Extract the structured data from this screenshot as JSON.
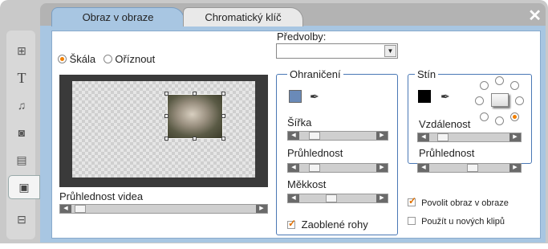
{
  "tabs": [
    {
      "label": "Obraz v obraze"
    },
    {
      "label": "Chromatický klíč"
    }
  ],
  "close_icon": "close-icon",
  "sidebar": {
    "items": [
      {
        "icon": "layout-icon"
      },
      {
        "icon": "title-text-icon"
      },
      {
        "icon": "audio-clip-icon"
      },
      {
        "icon": "camera-icon"
      },
      {
        "icon": "clapper-icon"
      },
      {
        "icon": "picture-in-picture-icon"
      },
      {
        "icon": "filmstrip-icon"
      }
    ]
  },
  "mode": {
    "scale_label": "Škála",
    "crop_label": "Oříznout",
    "selected": "scale"
  },
  "presets": {
    "label": "Předvolby:",
    "value": ""
  },
  "video_opacity": {
    "label": "Průhlednost videa",
    "value": 0.02
  },
  "border": {
    "title": "Ohraničení",
    "color": "#6a8ab8",
    "width_label": "Šířka",
    "width_value": 0.15,
    "opacity_label": "Průhlednost",
    "opacity_value": 0.15,
    "softness_label": "Měkkost",
    "softness_value": 0.4,
    "rounded_label": "Zaoblené rohy",
    "rounded_checked": true
  },
  "shadow": {
    "title": "Stín",
    "color": "#000000",
    "distance_label": "Vzdálenost",
    "distance_value": 0.12,
    "opacity_label": "Průhlednost",
    "opacity_value": 0.55,
    "direction": "bottom-right"
  },
  "options": {
    "enable_pip_label": "Povolit obraz v obraze",
    "enable_pip_checked": true,
    "use_new_clips_label": "Použít u nových klipů",
    "use_new_clips_checked": false
  }
}
